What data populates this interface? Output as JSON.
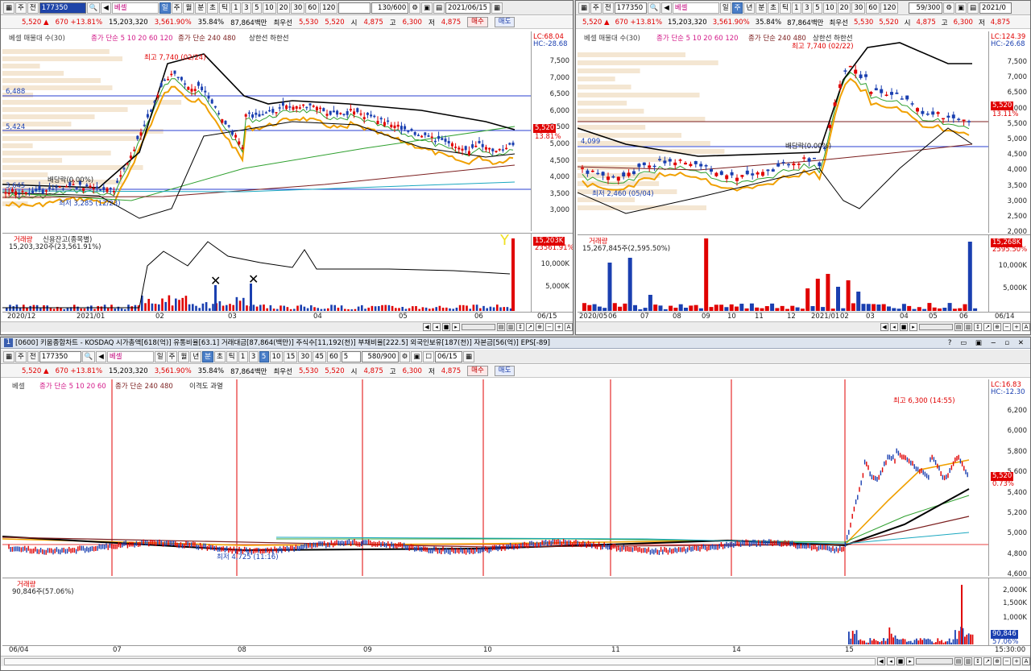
{
  "common": {
    "code": "177350",
    "item_name": "베셀",
    "tb_ju": "주",
    "tb_jeon": "전",
    "tb_il": "일",
    "tb_wol": "월",
    "tb_bun": "분",
    "tb_cho": "초",
    "tb_tik": "틱",
    "nums": [
      "1",
      "3",
      "5",
      "10",
      "20",
      "30",
      "60",
      "120"
    ],
    "buy_label": "매수",
    "sell_label": "매도",
    "date": "2021/06/15"
  },
  "quote": {
    "price": "5,520 ▲",
    "change": "670 +13.81%",
    "volume": "15,203,320",
    "vol_ratio": "3,561.90%",
    "turnover": "35.84%",
    "amount": "87,864백만",
    "best_ask_label": "최우선",
    "best_ask": "5,530",
    "best_bid": "5,520",
    "open_label": "시",
    "open": "4,875",
    "high_label": "고",
    "high": "6,300",
    "low_label": "저",
    "low": "4,875"
  },
  "w1": {
    "count": "130/600",
    "legend_main": "베셀 매물대 수(30)",
    "legend_ma": "종가 단순 5 10 20 60 120",
    "legend_ma2": "종가 단순 240 480",
    "legend_band": "상한선 하한선",
    "high_annot": "최고 7,740 (02/24)",
    "low_annot": "최저 3,285 (12/23)",
    "div_annot": "배당락(0.00%)",
    "lc": "LC:68.04",
    "hc": "HC:-28.68",
    "line_a": "6,488",
    "line_b": "5,424",
    "line_c": "3,645",
    "price_tag": "5,520",
    "pct_tag": "13.81%",
    "yticks": [
      "7,500",
      "7,000",
      "6,500",
      "6,000",
      "5,500",
      "5,000",
      "4,500",
      "4,000",
      "3,500",
      "3,000"
    ],
    "vol_legend": "거래량",
    "vol_legend2": "신용잔고(종목별)",
    "vol_value": "15,203,320주(23,561.91%)",
    "vol_tag": "15,203K",
    "vol_tag2": "23561.91%",
    "vol_ticks": [
      "10,000K",
      "5,000K"
    ],
    "xlabels": [
      "2020/12",
      "2021/01",
      "02",
      "03",
      "04",
      "05",
      "06"
    ],
    "last_date": "06/15"
  },
  "w2": {
    "count": "59/300",
    "date": "2021/0",
    "legend_main": "베셀 매물대 수(30)",
    "legend_ma": "종가 단순 5 10 20 60 120",
    "legend_ma2": "종가 단순 240 480",
    "legend_band": "상한선 하한선",
    "high_annot": "최고 7,740 (02/22)",
    "low_annot": "최저 2,460 (05/04)",
    "div_annot": "배당락(0.00%)",
    "lc": "LC:124.39",
    "hc": "HC:-26.68",
    "line_a": "4,099",
    "price_tag": "5,520",
    "pct_tag": "13.11%",
    "yticks": [
      "7,500",
      "7,000",
      "6,500",
      "6,000",
      "5,500",
      "5,000",
      "4,500",
      "4,000",
      "3,500",
      "3,000",
      "2,500",
      "2,000"
    ],
    "vol_legend": "거래량",
    "vol_value": "15,267,845주(2,595.50%)",
    "vol_tag": "15,268K",
    "vol_tag2": "2595.50%",
    "vol_ticks": [
      "15,000K",
      "10,000K",
      "5,000K"
    ],
    "xlabels": [
      "2020/05",
      "06",
      "07",
      "08",
      "09",
      "10",
      "11",
      "12",
      "2021/01",
      "02",
      "03",
      "04",
      "05",
      "06"
    ],
    "last_date": "06/14"
  },
  "w3": {
    "title": "[0600] 키움종합차트 - KOSDAQ 시가총액[618(억)] 유통비율[63.1] 거래대금[87,864(백만)] 주식수[11,192(천)] 부채비율[222.5] 외국인보유[187(천)] 자본금[56(억)] EPS[-89]",
    "win_num": "1",
    "count": "580/900",
    "date": "06/15",
    "legend_main": "베셀",
    "legend_ma": "종가 단순 5 10 20 60",
    "legend_ma2": "종가 단순 240 480",
    "legend_extra": "이격도 과열",
    "high_annot": "최고 6,300 (14:55)",
    "low_annot": "최저 4,725 (11:16)",
    "lc": "LC:16.83",
    "hc": "HC:-12.30",
    "price_tag": "5,520",
    "pct_tag": "0.73%",
    "yticks": [
      "6,200",
      "6,000",
      "5,800",
      "5,600",
      "5,400",
      "5,200",
      "5,000",
      "4,800",
      "4,600"
    ],
    "vol_legend": "거래량",
    "vol_value": "90,846주(57.06%)",
    "vol_tag": "90,846",
    "vol_tag2": "57.06%",
    "vol_ticks": [
      "2,000K",
      "1,500K",
      "1,000K",
      "500,000"
    ],
    "xlabels": [
      "06/04",
      "07",
      "08",
      "09",
      "10",
      "11",
      "14",
      "15"
    ],
    "last_time": "15:30:00",
    "toolbar_nums": [
      "1",
      "3",
      "5",
      "10",
      "15",
      "30",
      "45",
      "60"
    ],
    "toolbar_sel": "5"
  }
}
